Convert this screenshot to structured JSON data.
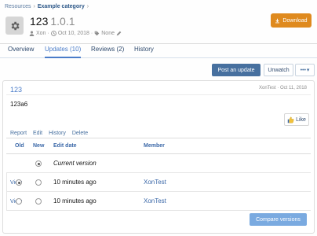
{
  "breadcrumb": {
    "items": [
      "Resources",
      "Example category"
    ]
  },
  "resource": {
    "title": "123",
    "version": "1.0.1",
    "author": "Xon",
    "date": "Oct 10, 2018",
    "tags": "None"
  },
  "download_label": "Download",
  "tabs": [
    {
      "label": "Overview",
      "active": false
    },
    {
      "label": "Updates (10)",
      "active": true
    },
    {
      "label": "Reviews (2)",
      "active": false
    },
    {
      "label": "History",
      "active": false
    }
  ],
  "toolbar": {
    "post_label": "Post an update",
    "unwatch_label": "Unwatch",
    "more_label": "•••"
  },
  "update": {
    "title": "123",
    "meta": "XonTest · Oct 11, 2018",
    "body": "123a6",
    "like_label": "Like"
  },
  "actions": [
    "Report",
    "Edit",
    "History",
    "Delete"
  ],
  "history": {
    "headers": {
      "old": "Old",
      "new": "New",
      "date": "Edit date",
      "member": "Member"
    },
    "rows": [
      {
        "date": "Current version",
        "member": "",
        "view": "",
        "old_radio": false,
        "new_radio": true,
        "new_checked": true,
        "old_checked": false,
        "italic": true
      },
      {
        "date": "10 minutes ago",
        "member": "XonTest",
        "view": "View",
        "old_radio": true,
        "new_radio": true,
        "old_checked": true,
        "new_checked": false,
        "italic": false
      },
      {
        "date": "10 minutes ago",
        "member": "XonTest",
        "view": "View",
        "old_radio": true,
        "new_radio": true,
        "old_checked": false,
        "new_checked": false,
        "italic": false
      }
    ]
  },
  "compare_label": "Compare versions",
  "colors": {
    "accent": "#47709f",
    "download": "#df8a1e",
    "link": "#4a7cc9",
    "compare": "#7aaae0"
  }
}
